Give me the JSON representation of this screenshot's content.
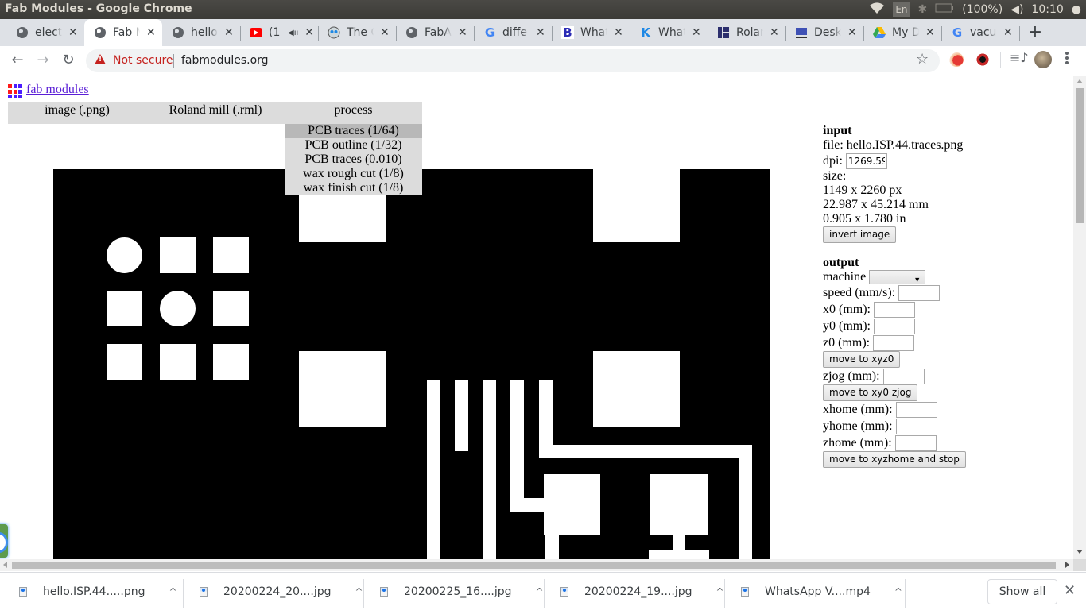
{
  "os": {
    "window_title": "Fab Modules - Google Chrome",
    "tray": {
      "keyboard": "En",
      "battery": "(100%)",
      "clock": "10:10"
    }
  },
  "tabs": [
    {
      "title": "elect",
      "icon": "globe-icon",
      "active": false
    },
    {
      "title": "Fab M",
      "icon": "globe-icon",
      "active": true
    },
    {
      "title": "hello",
      "icon": "globe-icon",
      "active": false
    },
    {
      "title": "(1",
      "icon": "youtube-icon",
      "active": false,
      "audio": true
    },
    {
      "title": "The C",
      "icon": "octocat-icon",
      "active": false
    },
    {
      "title": "FabA",
      "icon": "globe-icon",
      "active": false
    },
    {
      "title": "diffe",
      "icon": "google-icon",
      "active": false
    },
    {
      "title": "What",
      "icon": "b-logo-icon",
      "active": false
    },
    {
      "title": "What",
      "icon": "k-logo-icon",
      "active": false
    },
    {
      "title": "Rolar",
      "icon": "roland-icon",
      "active": false
    },
    {
      "title": "Desk",
      "icon": "desk-icon",
      "active": false
    },
    {
      "title": "My D",
      "icon": "drive-icon",
      "active": false
    },
    {
      "title": "vacu",
      "icon": "google-icon",
      "active": false
    }
  ],
  "toolbar": {
    "security_label": "Not secure",
    "url": "fabmodules.org"
  },
  "page": {
    "logo_link": "fab modules",
    "menu": [
      "image (.png)",
      "Roland mill (.rml)",
      "process"
    ],
    "process_options": [
      {
        "label": "PCB traces (1/64)",
        "highlighted": true
      },
      {
        "label": "PCB outline (1/32)",
        "highlighted": false
      },
      {
        "label": "PCB traces (0.010)",
        "highlighted": false
      },
      {
        "label": "wax rough cut (1/8)",
        "highlighted": false
      },
      {
        "label": "wax finish cut (1/8)",
        "highlighted": false
      }
    ],
    "input": {
      "heading": "input",
      "file_label": "file: hello.ISP.44.traces.png",
      "dpi_label": "dpi:",
      "dpi_value": "1269.59",
      "size_label": "size:",
      "size_px": "1149 x 2260 px",
      "size_mm": "22.987 x 45.214 mm",
      "size_in": "0.905 x 1.780 in",
      "invert_button": "invert image"
    },
    "output": {
      "heading": "output",
      "machine_label": "machine",
      "machine_value": "",
      "speed_label": "speed (mm/s):",
      "x0_label": "x0 (mm):",
      "y0_label": "y0 (mm):",
      "z0_label": "z0 (mm):",
      "move_xyz0_button": "move to xyz0",
      "zjog_label": "zjog (mm):",
      "move_xy0_zjog_button": "move to xy0 zjog",
      "xhome_label": "xhome (mm):",
      "yhome_label": "yhome (mm):",
      "zhome_label": "zhome (mm):",
      "move_home_button": "move to xyzhome and stop"
    }
  },
  "downloads": {
    "items": [
      {
        "name": "hello.ISP.44.....png"
      },
      {
        "name": "20200224_20....jpg"
      },
      {
        "name": "20200225_16....jpg"
      },
      {
        "name": "20200224_19....jpg"
      },
      {
        "name": "WhatsApp V....mp4"
      }
    ],
    "show_all": "Show all"
  }
}
